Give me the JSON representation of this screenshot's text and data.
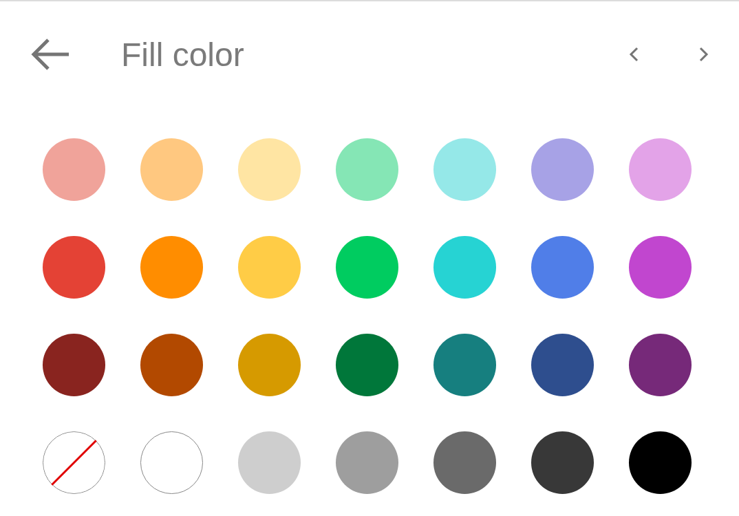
{
  "header": {
    "title": "Fill color"
  },
  "swatches": [
    {
      "kind": "solid",
      "color": "#f0a39a"
    },
    {
      "kind": "solid",
      "color": "#ffc880"
    },
    {
      "kind": "solid",
      "color": "#ffe5a3"
    },
    {
      "kind": "solid",
      "color": "#85e6b5"
    },
    {
      "kind": "solid",
      "color": "#95e8e8"
    },
    {
      "kind": "solid",
      "color": "#a7a2e6"
    },
    {
      "kind": "solid",
      "color": "#e3a3e8"
    },
    {
      "kind": "solid",
      "color": "#e44235"
    },
    {
      "kind": "solid",
      "color": "#ff8d00"
    },
    {
      "kind": "solid",
      "color": "#ffcc46"
    },
    {
      "kind": "solid",
      "color": "#00cc60"
    },
    {
      "kind": "solid",
      "color": "#26d3d3"
    },
    {
      "kind": "solid",
      "color": "#507ee8"
    },
    {
      "kind": "solid",
      "color": "#c146cf"
    },
    {
      "kind": "solid",
      "color": "#89241f"
    },
    {
      "kind": "solid",
      "color": "#b24900"
    },
    {
      "kind": "solid",
      "color": "#d69a00"
    },
    {
      "kind": "solid",
      "color": "#00773a"
    },
    {
      "kind": "solid",
      "color": "#167f7f"
    },
    {
      "kind": "solid",
      "color": "#2e4e8e"
    },
    {
      "kind": "solid",
      "color": "#762979"
    },
    {
      "kind": "none"
    },
    {
      "kind": "outlined",
      "color": "#ffffff"
    },
    {
      "kind": "solid",
      "color": "#cecece"
    },
    {
      "kind": "solid",
      "color": "#9e9e9e"
    },
    {
      "kind": "solid",
      "color": "#6a6a6a"
    },
    {
      "kind": "solid",
      "color": "#383838"
    },
    {
      "kind": "solid",
      "color": "#000000"
    }
  ]
}
